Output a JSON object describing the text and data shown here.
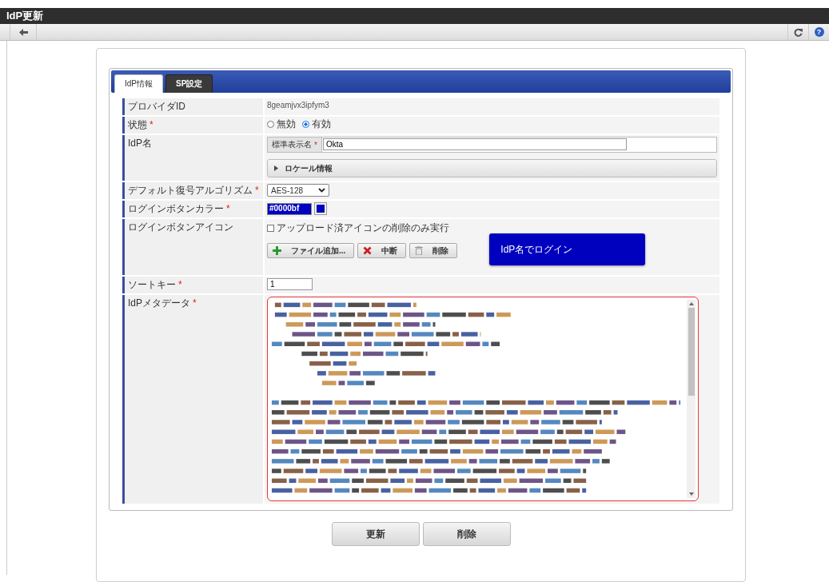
{
  "window": {
    "title": "IdP更新"
  },
  "toolbar": {
    "help": "?"
  },
  "required_mark": "*",
  "tabs": [
    {
      "label": "IdP情報",
      "selected": true
    },
    {
      "label": "SP設定",
      "selected": false
    }
  ],
  "rows": [
    {
      "kind": "text",
      "label": "プロバイダID",
      "required": false,
      "value": "8geamjvx3ipfym3"
    },
    {
      "kind": "radio",
      "label": "状態",
      "required": true,
      "options": [
        {
          "label": "無効",
          "selected": false
        },
        {
          "label": "有効",
          "selected": true
        }
      ]
    },
    {
      "kind": "name",
      "label": "IdP名",
      "required": false,
      "sub_label": "標準表示名",
      "sub_required": true,
      "value": "Okta",
      "section": {
        "label": "ロケール情報",
        "expanded": false
      }
    },
    {
      "kind": "select",
      "label": "デフォルト復号アルゴリズム",
      "required": true,
      "value": "AES-128"
    },
    {
      "kind": "color",
      "label": "ログインボタンカラー",
      "required": true,
      "value": "#0000bf"
    },
    {
      "kind": "icon",
      "label": "ログインボタンアイコン",
      "required": false,
      "checkbox": {
        "label": "アップロード済アイコンの削除のみ実行",
        "checked": false
      },
      "buttons": [
        {
          "label": "ファイル追加...",
          "kind": "plus"
        },
        {
          "label": "中断",
          "kind": "cross"
        },
        {
          "label": "削除",
          "kind": "trash"
        }
      ],
      "preview": "IdP名でログイン"
    },
    {
      "kind": "input",
      "label": "ソートキー",
      "required": true,
      "value": "1"
    },
    {
      "kind": "metadata",
      "label": "IdPメタデータ",
      "required": true,
      "focused": true
    }
  ],
  "buttons": [
    "更新",
    "削除"
  ]
}
